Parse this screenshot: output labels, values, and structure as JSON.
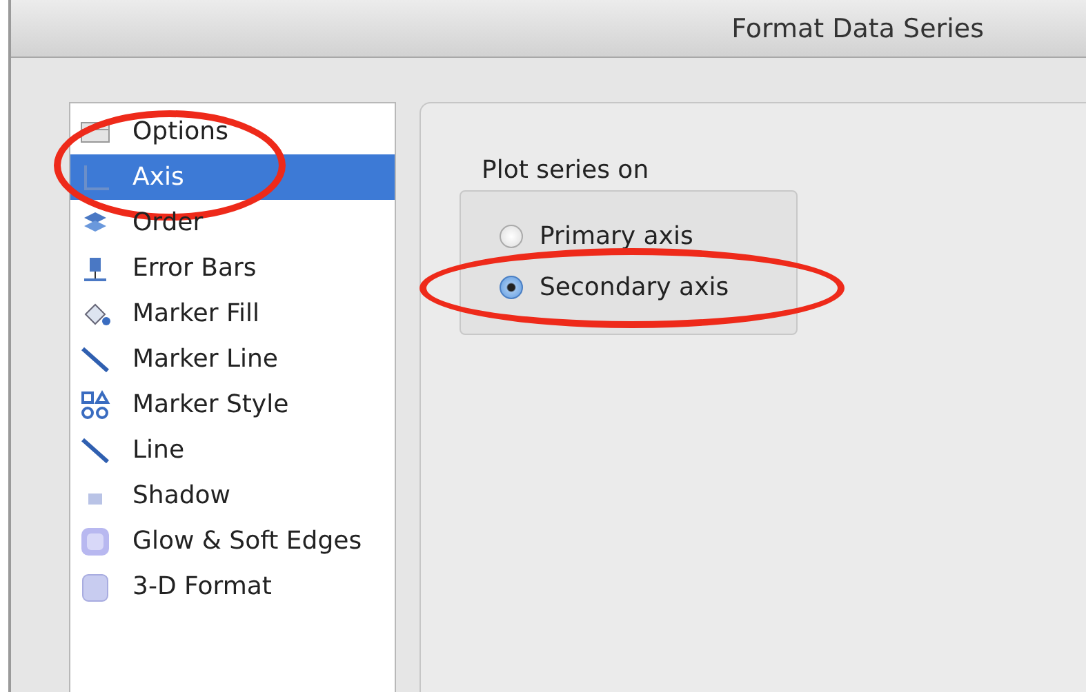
{
  "window": {
    "title": "Format Data Series"
  },
  "sidebar": {
    "items": [
      {
        "label": "Options",
        "kind": "options",
        "selected": false,
        "circled": false
      },
      {
        "label": "Axis",
        "kind": "axis",
        "selected": true,
        "circled": true
      },
      {
        "label": "Order",
        "kind": "order",
        "selected": false,
        "circled": false
      },
      {
        "label": "Error Bars",
        "kind": "error-bars",
        "selected": false,
        "circled": false
      },
      {
        "label": "Marker Fill",
        "kind": "fill",
        "selected": false,
        "circled": false
      },
      {
        "label": "Marker Line",
        "kind": "line",
        "selected": false,
        "circled": false
      },
      {
        "label": "Marker Style",
        "kind": "style",
        "selected": false,
        "circled": false
      },
      {
        "label": "Line",
        "kind": "line",
        "selected": false,
        "circled": false
      },
      {
        "label": "Shadow",
        "kind": "shadow",
        "selected": false,
        "circled": false
      },
      {
        "label": "Glow & Soft Edges",
        "kind": "glow",
        "selected": false,
        "circled": false
      },
      {
        "label": "3-D Format",
        "kind": "cube",
        "selected": false,
        "circled": false
      }
    ]
  },
  "panel": {
    "group_label": "Plot series on",
    "options": [
      {
        "label": "Primary axis",
        "selected": false,
        "circled": false
      },
      {
        "label": "Secondary axis",
        "selected": true,
        "circled": true
      }
    ]
  }
}
